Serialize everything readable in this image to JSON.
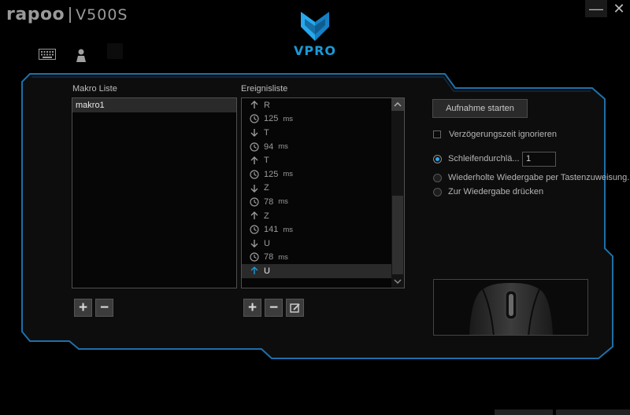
{
  "brand": {
    "logo": "rapoo",
    "model": "V500S",
    "product_logo": "VPRO"
  },
  "window": {
    "minimize_label": "—",
    "close_label": "✕"
  },
  "tabs": [
    {
      "icon": "keyboard-icon"
    },
    {
      "icon": "person-icon"
    },
    {
      "icon": "square-icon"
    }
  ],
  "macro_list": {
    "label": "Makro Liste",
    "items": [
      "makro1"
    ],
    "selected": 0
  },
  "event_list": {
    "label": "Ereignisliste",
    "unit": "ms",
    "events": [
      {
        "type": "up",
        "key": "R"
      },
      {
        "type": "delay",
        "value": "125"
      },
      {
        "type": "down",
        "key": "T"
      },
      {
        "type": "delay",
        "value": "94"
      },
      {
        "type": "up",
        "key": "T"
      },
      {
        "type": "delay",
        "value": "125"
      },
      {
        "type": "down",
        "key": "Z"
      },
      {
        "type": "delay",
        "value": "78"
      },
      {
        "type": "up",
        "key": "Z"
      },
      {
        "type": "delay",
        "value": "141"
      },
      {
        "type": "down",
        "key": "U"
      },
      {
        "type": "delay",
        "value": "78"
      },
      {
        "type": "up",
        "key": "U",
        "selected": true
      }
    ]
  },
  "buttons": {
    "add": "+",
    "remove": "−",
    "edit": "✎"
  },
  "options": {
    "record_label": "Aufnahme starten",
    "ignore_delay_label": "Verzögerungszeit ignorieren",
    "ignore_delay_checked": false,
    "loop_label": "Schleifendurchlä...",
    "loop_value": "1",
    "repeat_label": "Wiederholte Wiedergabe per Tastenzuweisung...",
    "press_label": "Zur Wiedergabe drücken",
    "selected_mode": "loop"
  },
  "colors": {
    "accent": "#1a9ad8",
    "frame": "#1f6fa8",
    "background": "#000000"
  }
}
